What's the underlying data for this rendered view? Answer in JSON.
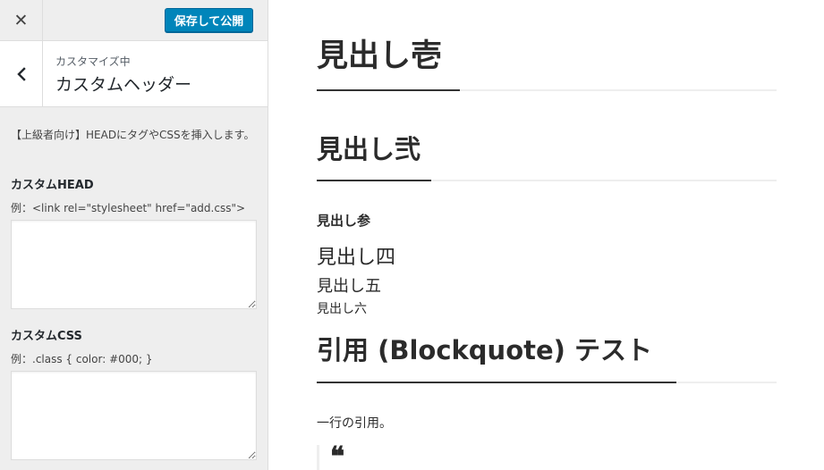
{
  "topbar": {
    "close_glyph": "✕",
    "publish_label": "保存して公開"
  },
  "section": {
    "subtitle": "カスタマイズ中",
    "title": "カスタムヘッダー",
    "description": "【上級者向け】HEADにタグやCSSを挿入します。"
  },
  "controls": {
    "head": {
      "label": "カスタムHEAD",
      "hint": "例：<link rel=\"stylesheet\" href=\"add.css\">",
      "value": ""
    },
    "css": {
      "label": "カスタムCSS",
      "hint": "例：.class { color: #000; }",
      "value": ""
    }
  },
  "preview": {
    "h1": "見出し壱",
    "h2": "見出し弐",
    "h3": "見出し参",
    "h4": "見出し四",
    "h5": "見出し五",
    "h6": "見出し六",
    "blockquote_heading": "引用 (Blockquote) テスト",
    "single_line_quote_intro": "一行の引用。",
    "quote_mark": "❝"
  },
  "colors": {
    "publish_button": "#0085ba",
    "sidebar_bg": "#eeeeee",
    "heading_rule_accent": "#333333"
  },
  "icons": {
    "close": "close-icon",
    "back": "chevron-left-icon"
  }
}
